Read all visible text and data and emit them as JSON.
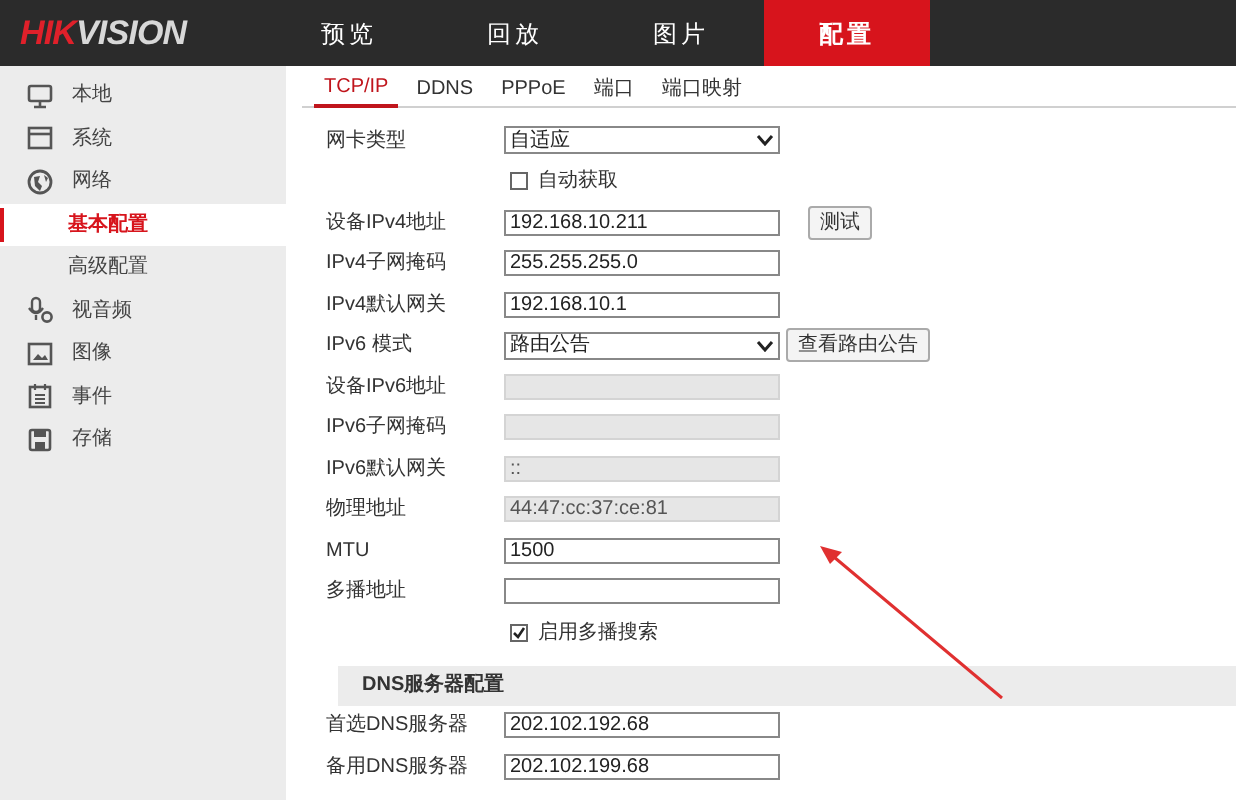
{
  "header": {
    "logo": {
      "brand": "HIK",
      "rest": "VISION"
    },
    "nav": [
      {
        "label": "预览",
        "selected": false
      },
      {
        "label": "回放",
        "selected": false
      },
      {
        "label": "图片",
        "selected": false
      },
      {
        "label": "配置",
        "selected": true
      }
    ]
  },
  "sidebar": {
    "items": [
      {
        "label": "本地",
        "selected": false
      },
      {
        "label": "系统",
        "selected": false
      },
      {
        "label": "网络",
        "selected": false,
        "children": [
          {
            "label": "基本配置",
            "selected": true
          },
          {
            "label": "高级配置",
            "selected": false
          }
        ]
      },
      {
        "label": "视音频",
        "selected": false
      },
      {
        "label": "图像",
        "selected": false
      },
      {
        "label": "事件",
        "selected": false
      },
      {
        "label": "存储",
        "selected": false
      }
    ]
  },
  "tabs": [
    {
      "label": "TCP/IP",
      "selected": true
    },
    {
      "label": "DDNS",
      "selected": false
    },
    {
      "label": "PPPoE",
      "selected": false
    },
    {
      "label": "端口",
      "selected": false
    },
    {
      "label": "端口映射",
      "selected": false
    }
  ],
  "form": [
    {
      "kind": "select",
      "label": "网卡类型",
      "value": "自适应"
    },
    {
      "kind": "checkbox",
      "label": "自动获取",
      "checked": false
    },
    {
      "kind": "text",
      "label": "设备IPv4地址",
      "value": "192.168.10.211",
      "disabled": false,
      "button": "测试"
    },
    {
      "kind": "text",
      "label": "IPv4子网掩码",
      "value": "255.255.255.0",
      "disabled": false
    },
    {
      "kind": "text",
      "label": "IPv4默认网关",
      "value": "192.168.10.1",
      "disabled": false
    },
    {
      "kind": "select",
      "label": "IPv6 模式",
      "value": "路由公告",
      "button": "查看路由公告"
    },
    {
      "kind": "text",
      "label": "设备IPv6地址",
      "disabled": true
    },
    {
      "kind": "text",
      "label": "IPv6子网掩码",
      "disabled": true
    },
    {
      "kind": "text",
      "label": "IPv6默认网关",
      "value": "::",
      "disabled": true
    },
    {
      "kind": "text",
      "label": "物理地址",
      "value": "44:47:cc:37:ce:81",
      "disabled": true
    },
    {
      "kind": "text",
      "label": "MTU",
      "value": "1500",
      "disabled": false
    },
    {
      "kind": "text",
      "label": "多播地址",
      "disabled": false
    },
    {
      "kind": "checkbox",
      "label": "启用多播搜索",
      "checked": true
    },
    {
      "kind": "section",
      "label": "DNS服务器配置"
    },
    {
      "kind": "text",
      "label": "首选DNS服务器",
      "value": "202.102.192.68",
      "disabled": false
    },
    {
      "kind": "text",
      "label": "备用DNS服务器",
      "value": "202.102.199.68",
      "disabled": false
    }
  ]
}
